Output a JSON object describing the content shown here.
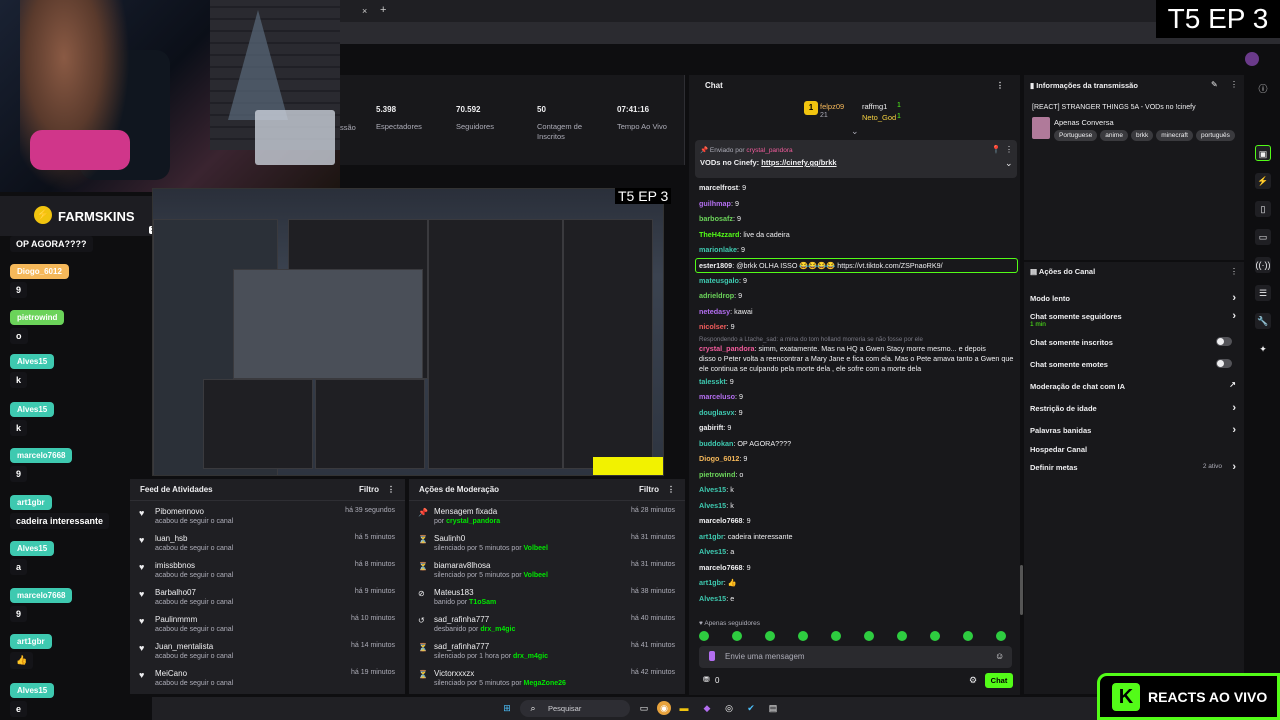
{
  "overlay": {
    "episode": "T5 EP 3",
    "nested_episode": "T5 EP 3",
    "reacts": "REACTS AO VIVO",
    "kick_letter": "K",
    "farmskins": "FARMSKINS",
    "age": "18+"
  },
  "browser": {
    "new_tab": "+",
    "close_tab": "×"
  },
  "stats": [
    {
      "value": "",
      "label": "ssão"
    },
    {
      "value": "5.398",
      "label": "Espectadores"
    },
    {
      "value": "70.592",
      "label": "Seguidores"
    },
    {
      "value": "50",
      "label": "Contagem de Inscritos"
    },
    {
      "value": "07:41:16",
      "label": "Tempo Ao Vivo"
    }
  ],
  "left_chat": [
    {
      "user": "",
      "msg": "OP AGORA????",
      "color": "#141418"
    },
    {
      "user": "Diogo_6012",
      "msg": "9",
      "color": "#f5b85a"
    },
    {
      "user": "pietrowind",
      "msg": "o",
      "color": "#6bd35a"
    },
    {
      "user": "Alves15",
      "msg": "k",
      "color": "#3ec9b0"
    },
    {
      "user": "Alves15",
      "msg": "k",
      "color": "#3ec9b0"
    },
    {
      "user": "marcelo7668",
      "msg": "9",
      "color": "#3ec9b0"
    },
    {
      "user": "art1gbr",
      "msg": "cadeira interessante",
      "color": "#3ec9b0"
    },
    {
      "user": "Alves15",
      "msg": "a",
      "color": "#3ec9b0"
    },
    {
      "user": "marcelo7668",
      "msg": "9",
      "color": "#3ec9b0"
    },
    {
      "user": "art1gbr",
      "msg": "👍",
      "color": "#3ec9b0"
    },
    {
      "user": "Alves15",
      "msg": "e",
      "color": "#3ec9b0"
    }
  ],
  "activity": {
    "title": "Feed de Atividades",
    "filter": "Filtro",
    "items": [
      {
        "user": "Pibomennovo",
        "action": "acabou de seguir o canal",
        "time": "há 39 segundos"
      },
      {
        "user": "luan_hsb",
        "action": "acabou de seguir o canal",
        "time": "há 5 minutos"
      },
      {
        "user": "imissbbnos",
        "action": "acabou de seguir o canal",
        "time": "há 8 minutos"
      },
      {
        "user": "Barbalho07",
        "action": "acabou de seguir o canal",
        "time": "há 9 minutos"
      },
      {
        "user": "Paulinmmm",
        "action": "acabou de seguir o canal",
        "time": "há 10 minutos"
      },
      {
        "user": "Juan_mentalista",
        "action": "acabou de seguir o canal",
        "time": "há 14 minutos"
      },
      {
        "user": "MeiCano",
        "action": "acabou de seguir o canal",
        "time": "há 19 minutos"
      }
    ]
  },
  "moderation": {
    "title": "Ações de Moderação",
    "filter": "Filtro",
    "items": [
      {
        "icon": "📌",
        "target": "Mensagem fixada",
        "pre": "por",
        "by": "crystal_pandora",
        "time": "há 28 minutos",
        "bycolor": "#00e701"
      },
      {
        "icon": "⏳",
        "target": "Saulinh0",
        "pre": "silenciado por 5 minutos por",
        "by": "Volbeel",
        "time": "há 31 minutos",
        "bycolor": "#00e701"
      },
      {
        "icon": "⏳",
        "target": "biamarav8lhosa",
        "pre": "silenciado por 5 minutos por",
        "by": "Volbeel",
        "time": "há 31 minutos",
        "bycolor": "#00e701"
      },
      {
        "icon": "⊘",
        "target": "Mateus183",
        "pre": "banido por",
        "by": "T1oSam",
        "time": "há 38 minutos",
        "bycolor": "#00e701"
      },
      {
        "icon": "↺",
        "target": "sad_rafinha777",
        "pre": "desbanido por",
        "by": "drx_m4gic",
        "time": "há 40 minutos",
        "bycolor": "#00e701"
      },
      {
        "icon": "⏳",
        "target": "sad_rafinha777",
        "pre": "silenciado por 1 hora por",
        "by": "drx_m4gic",
        "time": "há 41 minutos",
        "bycolor": "#00e701"
      },
      {
        "icon": "⏳",
        "target": "Victorxxxzx",
        "pre": "silenciado por 5 minutos por",
        "by": "MegaZone26",
        "time": "há 42 minutos",
        "bycolor": "#00e701"
      }
    ]
  },
  "chat": {
    "title": "Chat",
    "top": [
      {
        "rank": "1",
        "name": "felpz09",
        "count": "21",
        "color": "#f5b85a"
      },
      {
        "rank": "",
        "name": "raffmg1",
        "count": "1",
        "color": "#efeff1"
      },
      {
        "rank": "",
        "name": "Neto_God",
        "count": "1",
        "color": "#f5d142"
      }
    ],
    "pinned": {
      "sent_by": "Enviado por",
      "user": "crystal_pandora",
      "text": "VODs no Cinefy: ",
      "link": "https://cinefy.gg/brkk"
    },
    "reply_note": "Respondendo a Ltache_sad: a mina do tom holland morreria se não fosse por ele",
    "messages": [
      {
        "name": "marcelfrost",
        "text": "9",
        "color": "#efeff1"
      },
      {
        "name": "guilhmap",
        "text": "9",
        "color": "#b36ef0"
      },
      {
        "name": "barbosafz",
        "text": "9",
        "color": "#6bd35a"
      },
      {
        "name": "TheH4zzard",
        "text": "live da cadeira",
        "color": "#53fc18"
      },
      {
        "name": "marionlake",
        "text": "9",
        "color": "#3ec9b0"
      },
      {
        "name": "ester1809",
        "text": "@brkk OLHA ISSO 😂😂😂😂 https://vt.tiktok.com/ZSPnaoRK9/",
        "color": "#efeff1"
      },
      {
        "name": "mateusgalo",
        "text": "9",
        "color": "#3ec9b0"
      },
      {
        "name": "adrieldrop",
        "text": "9",
        "color": "#6bd35a"
      },
      {
        "name": "netedasy",
        "text": "kawai",
        "color": "#b36ef0"
      },
      {
        "name": "nicolser",
        "text": "9",
        "color": "#f25c5c"
      },
      {
        "name": "crystal_pandora",
        "text": "simm, exatamente. Mas na HQ a Gwen Stacy morre mesmo... e depois",
        "color": "#f25c9c"
      },
      {
        "name": "",
        "text": "disso o Peter volta a reencontrar a Mary Jane e fica com ela. Mas o Pete amava tanto a Gwen que",
        "color": "#efeff1"
      },
      {
        "name": "",
        "text": "ele continua se culpando pela morte dela , ele sofre com a morte dela",
        "color": "#efeff1"
      },
      {
        "name": "talesskt",
        "text": "9",
        "color": "#3ec9b0"
      },
      {
        "name": "marceluso",
        "text": "9",
        "color": "#b36ef0"
      },
      {
        "name": "douglasvx",
        "text": "9",
        "color": "#3ec9b0"
      },
      {
        "name": "gabirift",
        "text": "9",
        "color": "#efeff1"
      },
      {
        "name": "buddokan",
        "text": "OP AGORA????",
        "color": "#3ec9b0"
      },
      {
        "name": "Diogo_6012",
        "text": "9",
        "color": "#f5b85a"
      },
      {
        "name": "pietrowind",
        "text": "o",
        "color": "#6bd35a"
      },
      {
        "name": "Alves15",
        "text": "k",
        "color": "#3ec9b0"
      },
      {
        "name": "Alves15",
        "text": "k",
        "color": "#3ec9b0"
      },
      {
        "name": "marcelo7668",
        "text": "9",
        "color": "#efeff1"
      },
      {
        "name": "art1gbr",
        "text": "cadeira interessante",
        "color": "#3ec9b0"
      },
      {
        "name": "Alves15",
        "text": "a",
        "color": "#3ec9b0"
      },
      {
        "name": "marcelo7668",
        "text": "9",
        "color": "#efeff1"
      },
      {
        "name": "art1gbr",
        "text": "👍",
        "color": "#3ec9b0"
      },
      {
        "name": "Alves15",
        "text": "e",
        "color": "#3ec9b0"
      }
    ],
    "followers_only": "Apenas seguidores",
    "input_placeholder": "Envie uma mensagem",
    "count": "0",
    "send": "Chat"
  },
  "info": {
    "title": "Informações da transmissão",
    "stream_title": "[REACT] STRANGER THINGS 5A - VODs no !cinefy",
    "category": "Apenas Conversa",
    "tags": [
      "Portuguese",
      "anime",
      "brkk",
      "minecraft",
      "português"
    ]
  },
  "actions": {
    "title": "Ações do Canal",
    "items": [
      {
        "label": "Modo lento",
        "sub": "",
        "ctrl": "chevron"
      },
      {
        "label": "Chat somente seguidores",
        "sub": "1 min",
        "ctrl": "chevron"
      },
      {
        "label": "Chat somente inscritos",
        "sub": "",
        "ctrl": "toggle"
      },
      {
        "label": "Chat somente emotes",
        "sub": "",
        "ctrl": "toggle"
      },
      {
        "label": "Moderação de chat com IA",
        "sub": "",
        "ctrl": "ext"
      },
      {
        "label": "Restrição de idade",
        "sub": "",
        "ctrl": "chevron"
      },
      {
        "label": "Palavras banidas",
        "sub": "",
        "ctrl": "chevron"
      },
      {
        "label": "Hospedar Canal",
        "sub": "",
        "ctrl": "none"
      },
      {
        "label": "Definir metas",
        "sub": "2 ativo",
        "ctrl": "chevron"
      }
    ]
  },
  "taskbar": {
    "search": "Pesquisar"
  }
}
